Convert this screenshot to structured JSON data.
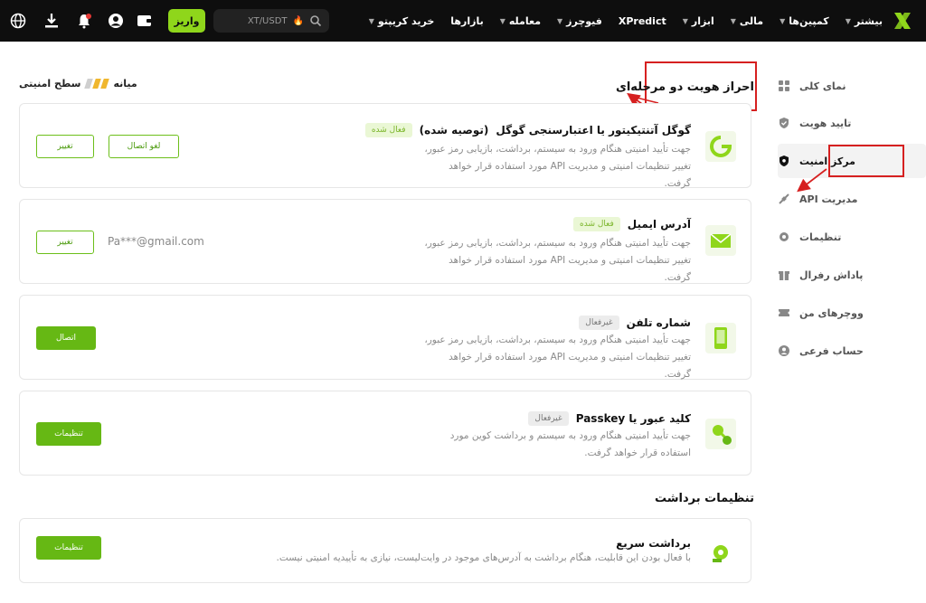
{
  "header": {
    "nav": [
      {
        "label": "خرید کریپتو",
        "caret": true
      },
      {
        "label": "بازارها",
        "caret": false
      },
      {
        "label": "معامله",
        "caret": true
      },
      {
        "label": "فیوچرز",
        "caret": true
      },
      {
        "label": "XPredict",
        "caret": false
      },
      {
        "label": "ابزار",
        "caret": true
      },
      {
        "label": "مالی",
        "caret": true
      },
      {
        "label": "کمپین‌ها",
        "caret": true
      },
      {
        "label": "بیشتر",
        "caret": true
      }
    ],
    "search_placeholder": "XT/USDT",
    "deposit_label": "واریز",
    "accent_color": "#8fd61b"
  },
  "sidebar": {
    "items": [
      {
        "label": "نمای کلی",
        "icon": "grid-icon",
        "active": false
      },
      {
        "label": "تایید هویت",
        "icon": "verified-icon",
        "active": false
      },
      {
        "label": "مرکز امنیت",
        "icon": "shield-icon",
        "active": true
      },
      {
        "label": "مدیریت API",
        "icon": "api-icon",
        "active": false
      },
      {
        "label": "تنظیمات",
        "icon": "gear-icon",
        "active": false
      },
      {
        "label": "پاداش رفرال",
        "icon": "gift-icon",
        "active": false
      },
      {
        "label": "ووچرهای من",
        "icon": "voucher-icon",
        "active": false
      },
      {
        "label": "حساب فرعی",
        "icon": "user-icon",
        "active": false
      }
    ]
  },
  "security": {
    "title": "احراز هویت دو مرحله‌ای",
    "level_label": "سطح امنیتی",
    "level_value": "میانه",
    "level_filled": 2,
    "level_total": 3,
    "cards": [
      {
        "title": "گوگل آتنتیکیتور یا اعتبارسنجی گوگل",
        "note": "(توصیه شده)",
        "status": "فعال شده",
        "desc": "جهت تأیید امنیتی هنگام ورود به سیستم، برداشت، بازیابی رمز عبور، تغییر تنظیمات امنیتی و مدیریت API مورد استفاده قرار خواهد گرفت.",
        "buttons": [
          "لغو اتصال",
          "تغییر"
        ]
      },
      {
        "title": "آدرس ایمیل",
        "status": "فعال شده",
        "desc": "جهت تأیید امنیتی هنگام ورود به سیستم، برداشت، بازیابی رمز عبور، تغییر تنظیمات امنیتی و مدیریت API مورد استفاده قرار خواهد گرفت.",
        "masked": "Pa***@gmail.com",
        "buttons": [
          "تغییر"
        ]
      },
      {
        "title": "شماره تلفن",
        "status": "غیرفعال",
        "desc": "جهت تأیید امنیتی هنگام ورود به سیستم، برداشت، بازیابی رمز عبور، تغییر تنظیمات امنیتی و مدیریت API مورد استفاده قرار خواهد گرفت.",
        "buttons": [
          "اتصال"
        ]
      },
      {
        "title": "کلید عبور یا Passkey",
        "status": "غیرفعال",
        "desc": "جهت تأیید امنیتی هنگام ورود به سیستم و برداشت کوین مورد استفاده قرار خواهد گرفت.",
        "buttons": [
          "تنظیمات"
        ]
      }
    ]
  },
  "withdraw": {
    "title": "تنظیمات برداشت",
    "cards": [
      {
        "title": "برداشت سریع",
        "desc": "با فعال بودن این قابلیت، هنگام برداشت به آدرس‌های موجود در وایت‌لیست، نیازی به تأییدیه امنیتی نیست.",
        "buttons": [
          "تنظیمات"
        ]
      }
    ]
  },
  "colors": {
    "green": "#66b814",
    "annotation_red": "#d62020"
  }
}
